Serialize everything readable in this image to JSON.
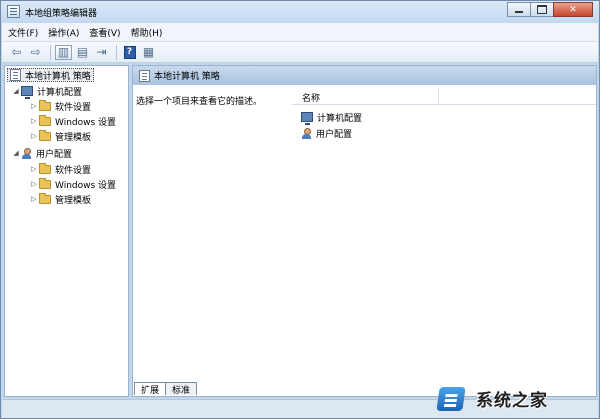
{
  "window": {
    "title": "本地组策略编辑器"
  },
  "menubar": {
    "items": [
      "文件(F)",
      "操作(A)",
      "查看(V)",
      "帮助(H)"
    ]
  },
  "toolbar": {
    "icons": [
      "back-arrow-icon",
      "forward-arrow-icon",
      "show-hide-tree-icon",
      "properties-icon",
      "export-icon",
      "help-icon",
      "show-hide-action-pane-icon"
    ],
    "help_glyph": "?"
  },
  "tree": {
    "root": "本地计算机 策略",
    "computer": {
      "label": "计算机配置",
      "children": [
        "软件设置",
        "Windows 设置",
        "管理模板"
      ]
    },
    "user": {
      "label": "用户配置",
      "children": [
        "软件设置",
        "Windows 设置",
        "管理模板"
      ]
    }
  },
  "main": {
    "header": "本地计算机 策略",
    "description": "选择一个项目来查看它的描述。",
    "column_name": "名称",
    "items": [
      "计算机配置",
      "用户配置"
    ],
    "tabs": [
      "扩展",
      "标准"
    ]
  },
  "watermark": {
    "text": "系统之家"
  }
}
